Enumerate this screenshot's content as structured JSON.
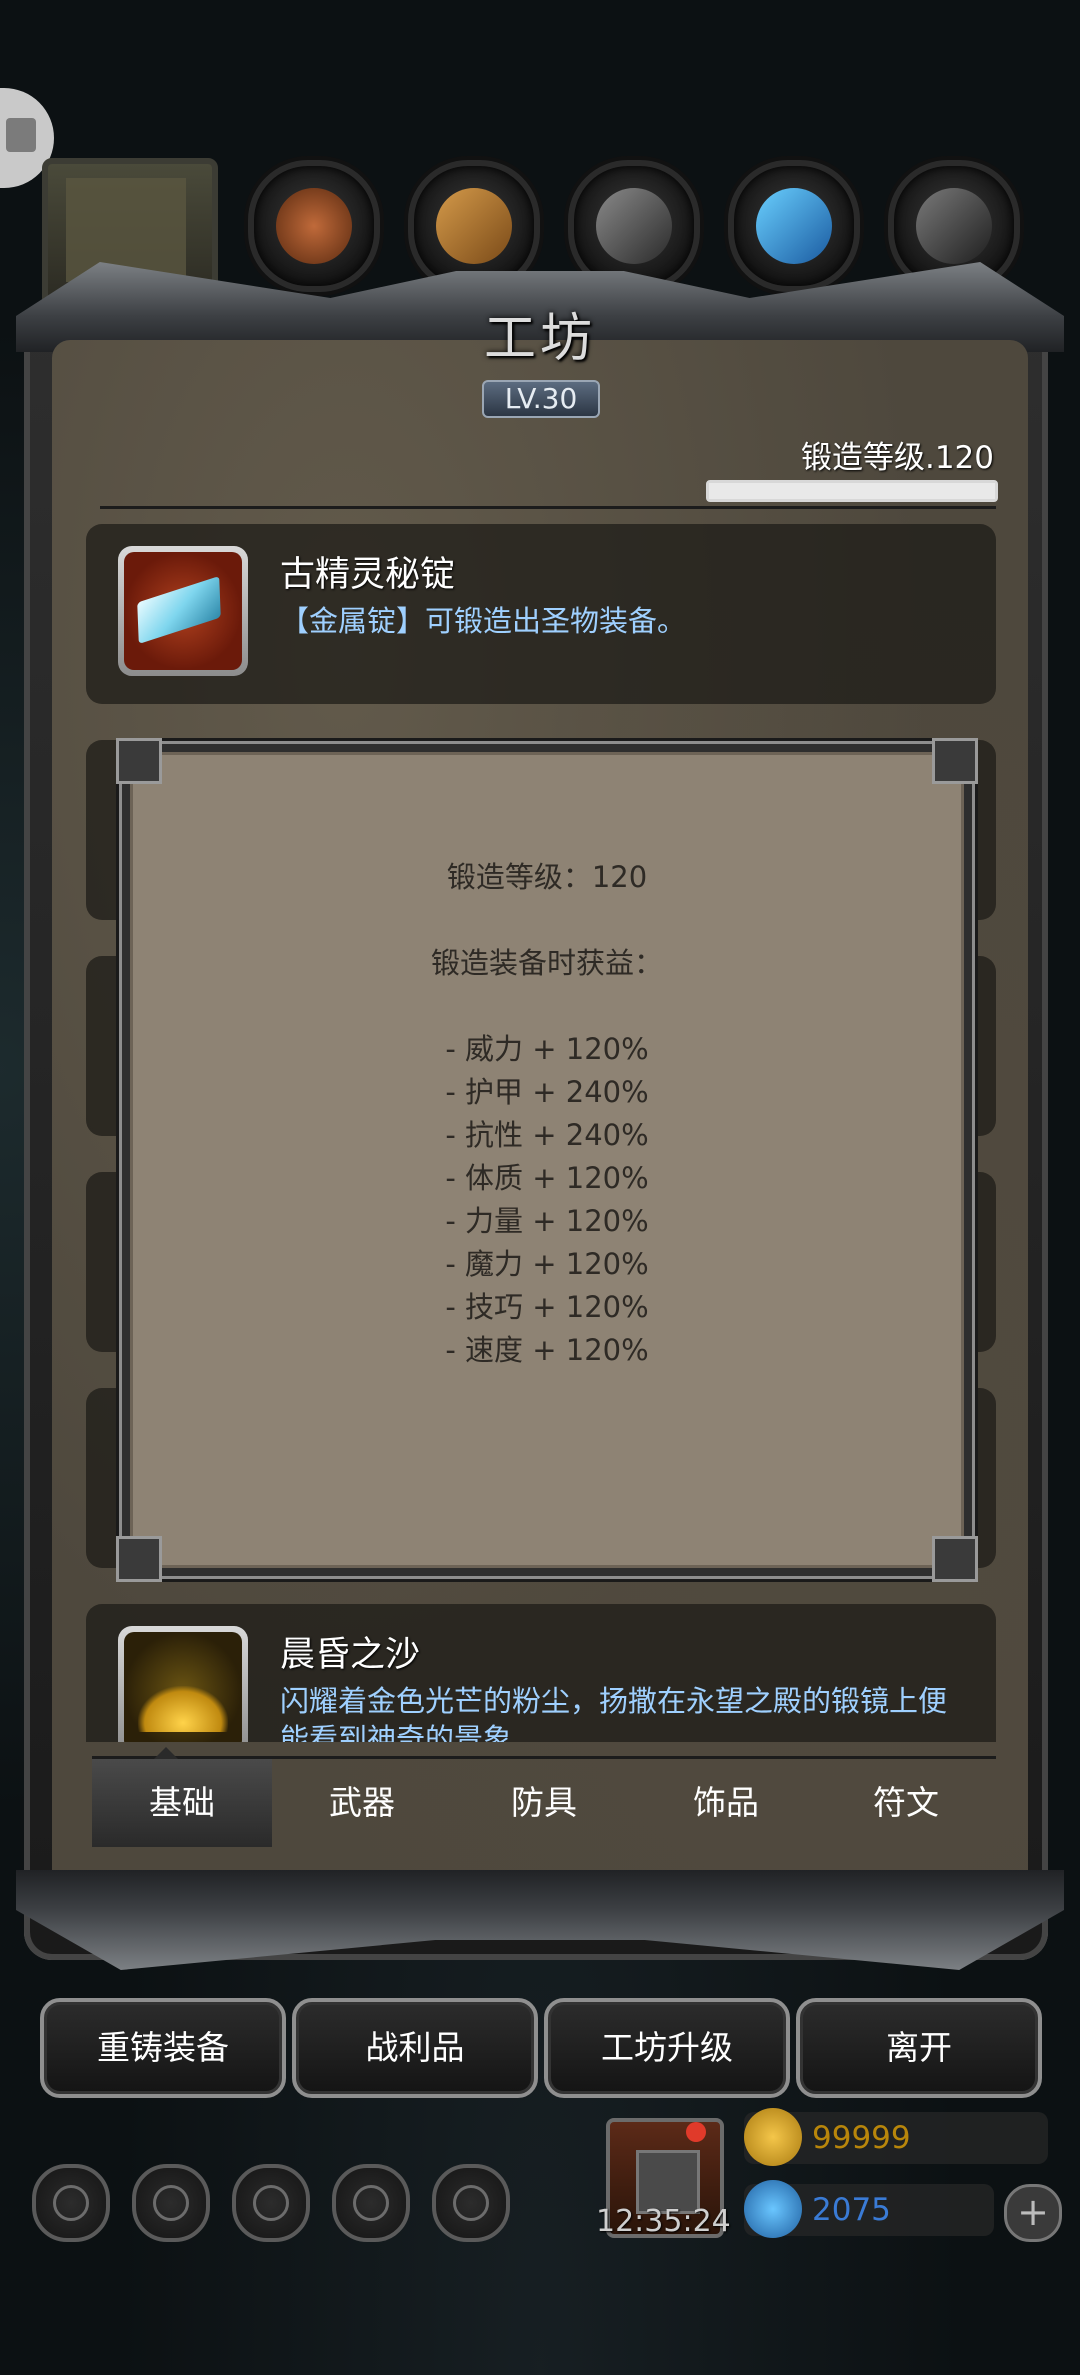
{
  "workshop": {
    "title": "工坊",
    "level_badge": "LV.30",
    "forge_level_label": "锻造等级.120",
    "forge_progress": 1.0
  },
  "category_icons": [
    "forge-icon",
    "leather-icon",
    "wood-icon",
    "metal-icon",
    "crystal-icon",
    "ingot-stack-icon"
  ],
  "items": [
    {
      "name": "古精灵秘锭",
      "description": "【金属锭】可锻造出圣物装备。",
      "icon": "blue-ingot-icon"
    },
    {
      "name": "晨昏之沙",
      "description": "闪耀着金色光芒的粉尘，扬撒在永望之殿的锻镜上便能看到神奇的景象",
      "icon": "golden-sand-icon"
    }
  ],
  "tooltip": {
    "forge_level_line": "锻造等级：120",
    "bonus_heading": "锻造装备时获益：",
    "bonuses": [
      "- 威力 + 120%",
      "- 护甲 + 240%",
      "- 抗性 + 240%",
      "- 体质 + 120%",
      "- 力量 + 120%",
      "- 魔力 + 120%",
      "- 技巧 + 120%",
      "- 速度 + 120%"
    ]
  },
  "tabs": [
    "基础",
    "武器",
    "防具",
    "饰品",
    "符文"
  ],
  "active_tab": "基础",
  "actions": [
    "重铸装备",
    "战利品",
    "工坊升级",
    "离开"
  ],
  "bottom_bar": {
    "clock": "12:35:24",
    "gold": "99999",
    "gems": "2075",
    "gold_color": "#b8860b",
    "gem_color": "#3a7bd5"
  }
}
